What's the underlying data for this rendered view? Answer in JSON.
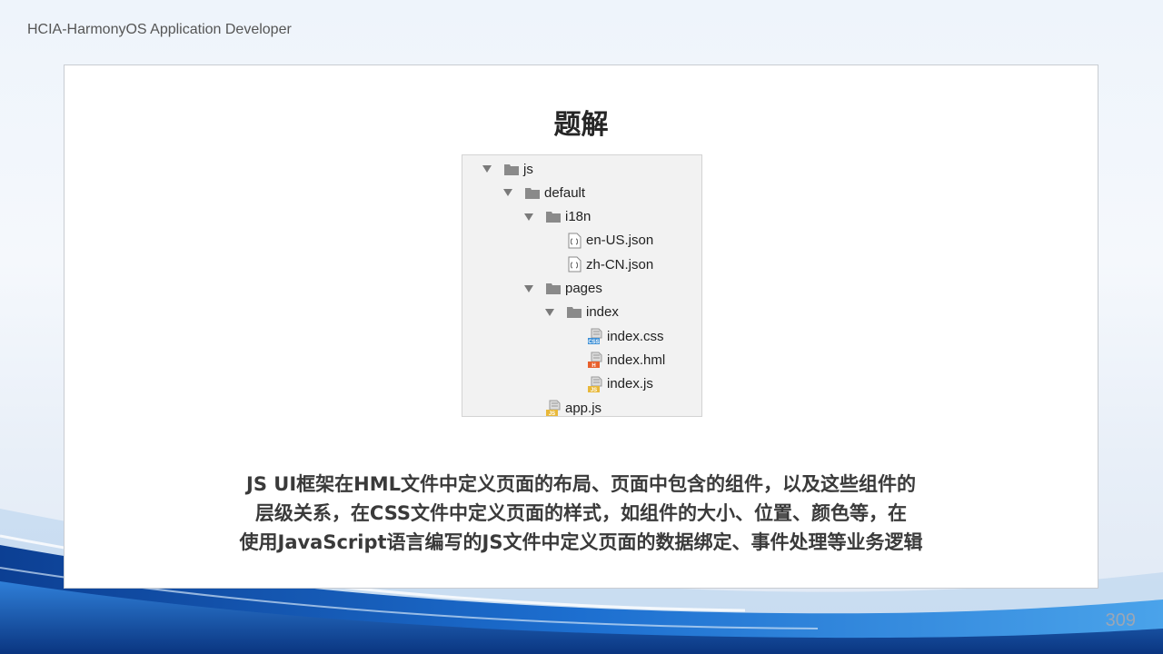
{
  "header": {
    "course": "HCIA-HarmonyOS Application Developer"
  },
  "slide": {
    "title": "题解",
    "tree": [
      {
        "label": "js",
        "kind": "folder",
        "level": 0,
        "expanded": true
      },
      {
        "label": "default",
        "kind": "folder",
        "level": 1,
        "expanded": true
      },
      {
        "label": "i18n",
        "kind": "folder",
        "level": 2,
        "expanded": true
      },
      {
        "label": "en-US.json",
        "kind": "json-file",
        "level": 3
      },
      {
        "label": "zh-CN.json",
        "kind": "json-file",
        "level": 3
      },
      {
        "label": "pages",
        "kind": "folder",
        "level": 2,
        "expanded": true
      },
      {
        "label": "index",
        "kind": "folder",
        "level": 3,
        "expanded": true
      },
      {
        "label": "index.css",
        "kind": "css-file",
        "level": 4
      },
      {
        "label": "index.hml",
        "kind": "hml-file",
        "level": 4
      },
      {
        "label": "index.js",
        "kind": "js-file",
        "level": 4
      },
      {
        "label": "app.js",
        "kind": "js-file",
        "level": 2
      }
    ],
    "description": [
      "JS UI框架在HML文件中定义页面的布局、页面中包含的组件，以及这些组件的",
      "层级关系，在CSS文件中定义页面的样式，如组件的大小、位置、颜色等，在",
      "使用JavaScript语言编写的JS文件中定义页面的数据绑定、事件处理等业务逻辑"
    ]
  },
  "footer": {
    "page_number": "309"
  },
  "colors": {
    "folder": "#8a8a8a",
    "css_badge": "#3c8fd6",
    "hml_badge": "#e8602c",
    "js_badge": "#e8b83a"
  }
}
